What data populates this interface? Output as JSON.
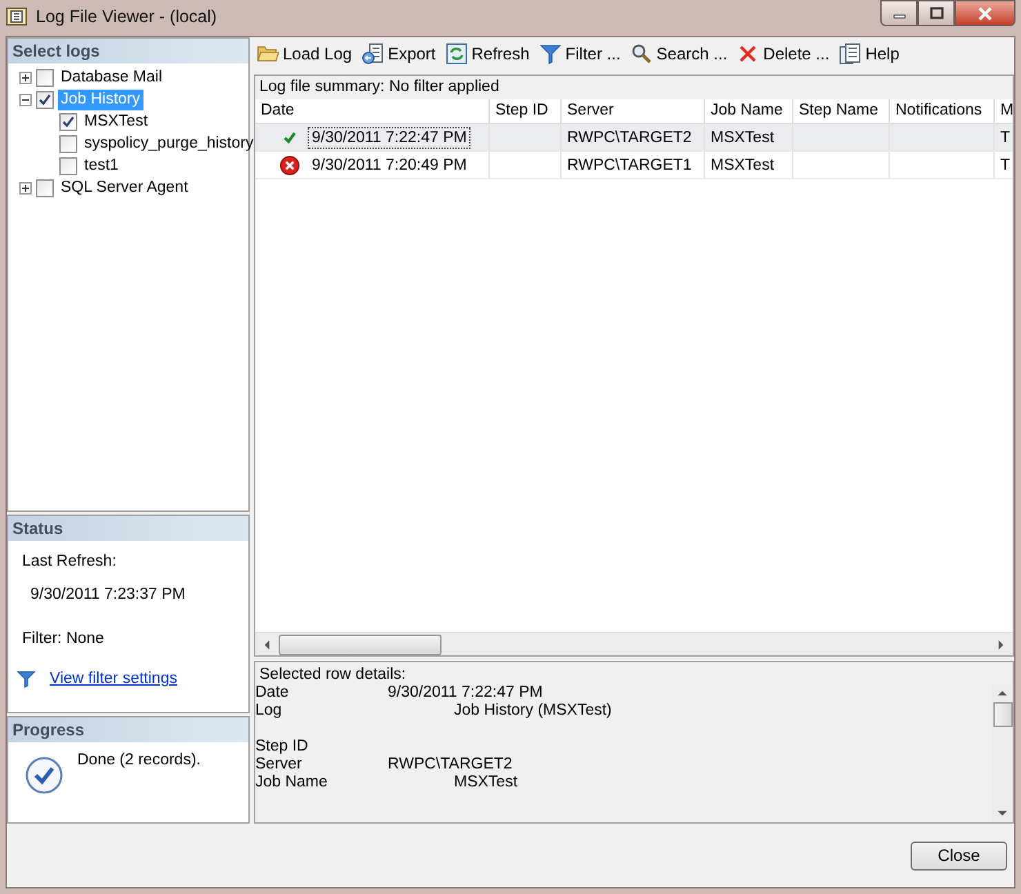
{
  "window": {
    "title": "Log File Viewer - (local)"
  },
  "select_logs": {
    "title": "Select logs",
    "tree": [
      {
        "label": "Database Mail",
        "checked": false,
        "expanded": false,
        "selected": false
      },
      {
        "label": "Job History",
        "checked": true,
        "expanded": true,
        "selected": true,
        "children": [
          {
            "label": "MSXTest",
            "checked": true,
            "selected": false
          },
          {
            "label": "syspolicy_purge_history",
            "checked": false,
            "selected": false
          },
          {
            "label": "test1",
            "checked": false,
            "selected": false
          }
        ]
      },
      {
        "label": "SQL Server Agent",
        "checked": false,
        "expanded": false,
        "selected": false
      }
    ]
  },
  "status": {
    "title": "Status",
    "last_refresh_label": "Last Refresh:",
    "last_refresh": "9/30/2011 7:23:37 PM",
    "filter": "Filter: None",
    "link": "View filter settings"
  },
  "progress": {
    "title": "Progress",
    "message": "Done (2 records)."
  },
  "toolbar": [
    {
      "kind": "folder",
      "label": "Load Log"
    },
    {
      "kind": "export",
      "label": "Export"
    },
    {
      "kind": "refresh",
      "label": "Refresh"
    },
    {
      "kind": "filter",
      "label": "Filter ..."
    },
    {
      "kind": "search",
      "label": "Search ..."
    },
    {
      "kind": "delete",
      "label": "Delete ..."
    },
    {
      "kind": "help",
      "label": "Help"
    }
  ],
  "summary": "Log file summary: No filter applied",
  "table": {
    "columns": [
      "Date",
      "Step ID",
      "Server",
      "Job Name",
      "Step Name",
      "Notifications",
      "M"
    ],
    "rows": [
      {
        "kind": "success",
        "selected": true,
        "cells": [
          "9/30/2011 7:22:47 PM",
          "",
          "RWPC\\TARGET2",
          "MSXTest",
          "",
          "",
          "T"
        ]
      },
      {
        "kind": "failure",
        "selected": false,
        "cells": [
          "9/30/2011 7:20:49 PM",
          "",
          "RWPC\\TARGET1",
          "MSXTest",
          "",
          "",
          "T"
        ]
      }
    ]
  },
  "details": {
    "title": "Selected row details:",
    "groups": [
      {
        "rows": [
          {
            "label": "Date",
            "value": "9/30/2011 7:22:47 PM"
          },
          {
            "label": "Log",
            "value": "Job History (MSXTest)"
          }
        ]
      },
      {
        "rows": [
          {
            "label": "Step ID",
            "value": ""
          },
          {
            "label": "Server",
            "value": "RWPC\\TARGET2"
          },
          {
            "label": "Job Name",
            "value": "MSXTest"
          }
        ]
      }
    ]
  },
  "buttons": [
    "Close"
  ]
}
